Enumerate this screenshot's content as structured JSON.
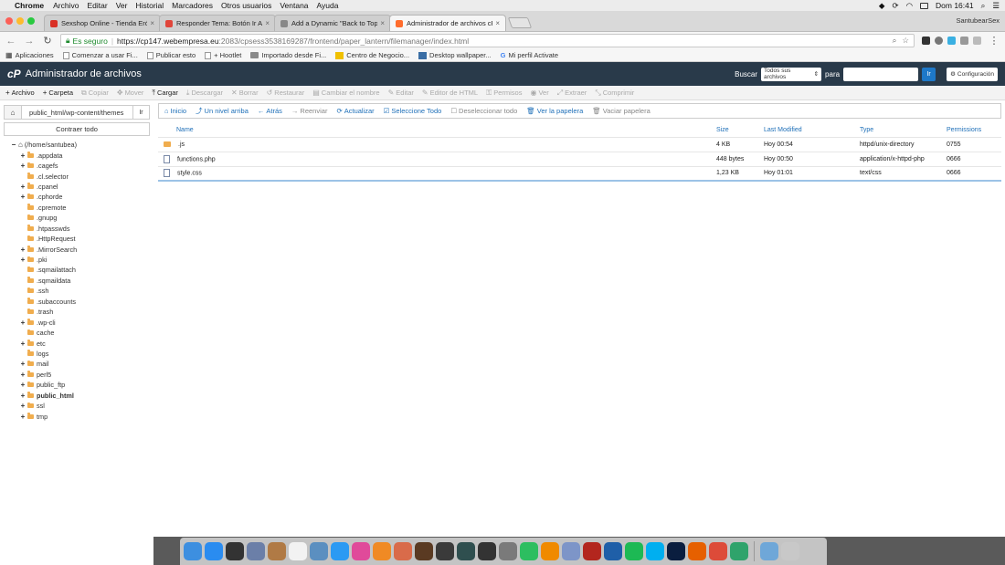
{
  "menubar": {
    "app": "Chrome",
    "items": [
      "Archivo",
      "Editar",
      "Ver",
      "Historial",
      "Marcadores",
      "Otros usuarios",
      "Ventana",
      "Ayuda"
    ],
    "clock": "Dom 16:41"
  },
  "browser": {
    "tabs": [
      {
        "title": "Sexshop Online - Tienda Erótica",
        "color": "#d93025"
      },
      {
        "title": "Responder Tema: Botón Ir Arriba",
        "color": "#e0453a"
      },
      {
        "title": "Add a Dynamic \"Back to Top\" Button",
        "color": "#888888"
      },
      {
        "title": "Administrador de archivos cPanel",
        "color": "#ff6c2c"
      }
    ],
    "profile": "SantubearSex",
    "address": {
      "secure_label": "Es seguro",
      "separator": "|",
      "host": "https://cp147.webempresa.eu",
      "path": ":2083/cpsess3538169287/frontend/paper_lantern/filemanager/index.html"
    },
    "bookmarks": [
      "Aplicaciones",
      "Comenzar a usar Fi...",
      "Publicar esto",
      "+ Hootlet",
      "Importado desde Fi...",
      "Centro de Negocio...",
      "Desktop wallpaper...",
      "Mi perfil Activate"
    ]
  },
  "cpanel": {
    "logo": "cP",
    "title": "Administrador de archivos",
    "search_label": "Buscar",
    "search_scope": "Todos sus archivos",
    "para_label": "para",
    "go_label": "Ir",
    "settings_label": "Configuración"
  },
  "toolbar": {
    "items": [
      {
        "label": "Archivo",
        "icon": "+",
        "enabled": true
      },
      {
        "label": "Carpeta",
        "icon": "+",
        "enabled": true
      },
      {
        "label": "Copiar",
        "icon": "⧉",
        "enabled": false
      },
      {
        "label": "Mover",
        "icon": "✥",
        "enabled": false
      },
      {
        "label": "Cargar",
        "icon": "⤒",
        "enabled": true
      },
      {
        "label": "Descargar",
        "icon": "⤓",
        "enabled": false
      },
      {
        "label": "Borrar",
        "icon": "✕",
        "enabled": false
      },
      {
        "label": "Restaurar",
        "icon": "↺",
        "enabled": false
      },
      {
        "label": "Cambiar el nombre",
        "icon": "▤",
        "enabled": false
      },
      {
        "label": "Editar",
        "icon": "✎",
        "enabled": false
      },
      {
        "label": "Editor de HTML",
        "icon": "✎",
        "enabled": false
      },
      {
        "label": "Permisos",
        "icon": "⚿",
        "enabled": false
      },
      {
        "label": "Ver",
        "icon": "◉",
        "enabled": false
      },
      {
        "label": "Extraer",
        "icon": "⤢",
        "enabled": false
      },
      {
        "label": "Comprimir",
        "icon": "⤡",
        "enabled": false
      }
    ]
  },
  "leftpane": {
    "path_value": "public_html/wp-content/themes",
    "go_label": "Ir",
    "collapse_label": "Contraer todo",
    "root_label": "(/home/santubea)",
    "tree": [
      {
        "name": ".appdata",
        "expandable": true,
        "bold": false
      },
      {
        "name": ".cagefs",
        "expandable": true,
        "bold": false
      },
      {
        "name": ".cl.selector",
        "expandable": false,
        "bold": false
      },
      {
        "name": ".cpanel",
        "expandable": true,
        "bold": false
      },
      {
        "name": ".cphorde",
        "expandable": true,
        "bold": false
      },
      {
        "name": ".cpremote",
        "expandable": false,
        "bold": false
      },
      {
        "name": ".gnupg",
        "expandable": false,
        "bold": false
      },
      {
        "name": ".htpasswds",
        "expandable": false,
        "bold": false
      },
      {
        "name": ".HttpRequest",
        "expandable": false,
        "bold": false
      },
      {
        "name": ".MirrorSearch",
        "expandable": true,
        "bold": false
      },
      {
        "name": ".pki",
        "expandable": true,
        "bold": false
      },
      {
        "name": ".sqmailattach",
        "expandable": false,
        "bold": false
      },
      {
        "name": ".sqmaildata",
        "expandable": false,
        "bold": false
      },
      {
        "name": ".ssh",
        "expandable": false,
        "bold": false
      },
      {
        "name": ".subaccounts",
        "expandable": false,
        "bold": false
      },
      {
        "name": ".trash",
        "expandable": false,
        "bold": false
      },
      {
        "name": ".wp-cli",
        "expandable": true,
        "bold": false
      },
      {
        "name": "cache",
        "expandable": false,
        "bold": false
      },
      {
        "name": "etc",
        "expandable": true,
        "bold": false
      },
      {
        "name": "logs",
        "expandable": false,
        "bold": false
      },
      {
        "name": "mail",
        "expandable": true,
        "bold": false
      },
      {
        "name": "perl5",
        "expandable": true,
        "bold": false
      },
      {
        "name": "public_ftp",
        "expandable": true,
        "bold": false
      },
      {
        "name": "public_html",
        "expandable": true,
        "bold": true
      },
      {
        "name": "ssl",
        "expandable": true,
        "bold": false
      },
      {
        "name": "tmp",
        "expandable": true,
        "bold": false
      }
    ]
  },
  "navrow": {
    "items": [
      {
        "label": "Inicio",
        "icon": "⌂",
        "enabled": true
      },
      {
        "label": "Un nivel arriba",
        "icon": "⤴",
        "enabled": true
      },
      {
        "label": "Atrás",
        "icon": "←",
        "enabled": true
      },
      {
        "label": "Reenviar",
        "icon": "→",
        "enabled": false
      },
      {
        "label": "Actualizar",
        "icon": "⟳",
        "enabled": true
      },
      {
        "label": "Seleccione Todo",
        "icon": "☑",
        "enabled": true
      },
      {
        "label": "Deseleccionar todo",
        "icon": "☐",
        "enabled": false
      },
      {
        "label": "Ver la papelera",
        "icon": "🗑",
        "enabled": true
      },
      {
        "label": "Vaciar papelera",
        "icon": "🗑",
        "enabled": false
      }
    ]
  },
  "filetable": {
    "headers": {
      "name": "Name",
      "size": "Size",
      "modified": "Last Modified",
      "type": "Type",
      "perms": "Permissions"
    },
    "rows": [
      {
        "name": ".js",
        "kind": "folder",
        "size": "4 KB",
        "modified": "Hoy 00:54",
        "type": "httpd/unix-directory",
        "perms": "0755"
      },
      {
        "name": "functions.php",
        "kind": "file",
        "size": "448 bytes",
        "modified": "Hoy 00:50",
        "type": "application/x-httpd-php",
        "perms": "0666"
      },
      {
        "name": "style.css",
        "kind": "file",
        "size": "1,23 KB",
        "modified": "Hoy 01:01",
        "type": "text/css",
        "perms": "0666"
      }
    ]
  },
  "dock": {
    "apps": [
      {
        "name": "finder-icon",
        "color": "#3d8fe0"
      },
      {
        "name": "app-store-icon",
        "color": "#2a8cf0"
      },
      {
        "name": "dashboard-icon",
        "color": "#333333"
      },
      {
        "name": "preview-icon",
        "color": "#6b7fa8"
      },
      {
        "name": "contacts-icon",
        "color": "#b07a45"
      },
      {
        "name": "calendar-icon",
        "color": "#f2f2f2"
      },
      {
        "name": "photos-icon",
        "color": "#5b8fc0"
      },
      {
        "name": "safari-icon",
        "color": "#2b9af3"
      },
      {
        "name": "itunes-icon",
        "color": "#e04a9a"
      },
      {
        "name": "ibooks-icon",
        "color": "#f08a24"
      },
      {
        "name": "photos-app-icon",
        "color": "#d96b4a"
      },
      {
        "name": "garageband-icon",
        "color": "#5a3a22"
      },
      {
        "name": "guitar-icon",
        "color": "#3a3a3a"
      },
      {
        "name": "time-machine-icon",
        "color": "#2f4f4f"
      },
      {
        "name": "activity-icon",
        "color": "#333333"
      },
      {
        "name": "system-prefs-icon",
        "color": "#7a7a7a"
      },
      {
        "name": "evernote-icon",
        "color": "#2dbe60"
      },
      {
        "name": "vlc-icon",
        "color": "#f08a00"
      },
      {
        "name": "preview-app-icon",
        "color": "#7d95c8"
      },
      {
        "name": "filezilla-icon",
        "color": "#b3261e"
      },
      {
        "name": "quicktime-icon",
        "color": "#1f5fa8"
      },
      {
        "name": "spotify-icon",
        "color": "#1db954"
      },
      {
        "name": "skype-icon",
        "color": "#00aff0"
      },
      {
        "name": "photoshop-icon",
        "color": "#0a1e3f"
      },
      {
        "name": "firefox-icon",
        "color": "#e66000"
      },
      {
        "name": "chrome-icon",
        "color": "#dd4b39"
      },
      {
        "name": "vpn-icon",
        "color": "#2fa36b"
      },
      {
        "name": "downloads-icon",
        "color": "#6fa7d8"
      },
      {
        "name": "trash-icon",
        "color": "#c8c8c8"
      }
    ]
  }
}
